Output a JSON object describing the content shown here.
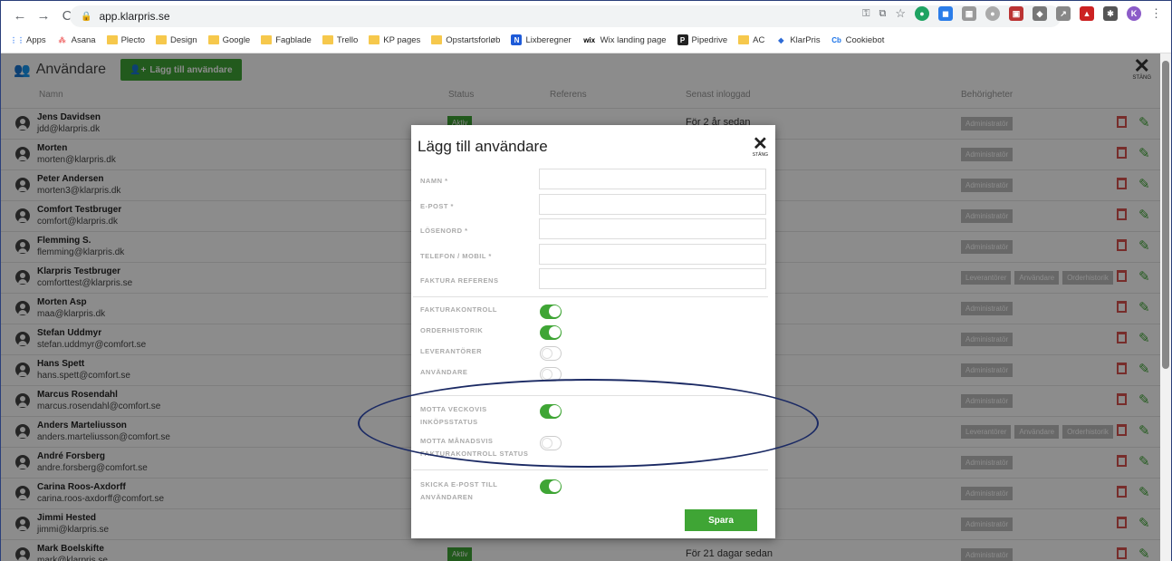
{
  "browser": {
    "url": "app.klarpris.se",
    "bookmarks": [
      {
        "label": "Apps",
        "icon": "apps-grid-icon"
      },
      {
        "label": "Asana",
        "icon": "asana-icon"
      },
      {
        "label": "Plecto",
        "icon": "folder-icon"
      },
      {
        "label": "Design",
        "icon": "folder-icon"
      },
      {
        "label": "Google",
        "icon": "folder-icon"
      },
      {
        "label": "Fagblade",
        "icon": "folder-icon"
      },
      {
        "label": "Trello",
        "icon": "folder-icon"
      },
      {
        "label": "KP pages",
        "icon": "folder-icon"
      },
      {
        "label": "Opstartsforløb",
        "icon": "folder-icon"
      },
      {
        "label": "Lixberegner",
        "icon": "n-icon"
      },
      {
        "label": "Wix landing page",
        "icon": "wix-icon"
      },
      {
        "label": "Pipedrive",
        "icon": "p-icon"
      },
      {
        "label": "AC",
        "icon": "folder-icon"
      },
      {
        "label": "KlarPris",
        "icon": "klarpris-icon"
      },
      {
        "label": "Cookiebot",
        "icon": "cookiebot-icon"
      }
    ],
    "profile_initial": "K"
  },
  "header": {
    "title": "Användare",
    "add_button": "Lägg till användare",
    "close_label": "STÄNG"
  },
  "table": {
    "columns": {
      "name": "Namn",
      "status": "Status",
      "reference": "Referens",
      "last_login": "Senast inloggad",
      "permissions": "Behörigheter"
    },
    "rows": [
      {
        "name": "Jens Davidsen",
        "email": "jdd@klarpris.dk",
        "status": "Aktiv",
        "last": "För 2 år sedan",
        "perms": [
          "Administratör"
        ]
      },
      {
        "name": "Morten",
        "email": "morten@klarpris.dk",
        "status": "",
        "last": "",
        "perms": [
          "Administratör"
        ]
      },
      {
        "name": "Peter Andersen",
        "email": "morten3@klarpris.dk",
        "status": "",
        "last": "",
        "perms": [
          "Administratör"
        ]
      },
      {
        "name": "Comfort Testbruger",
        "email": "comfort@klarpris.dk",
        "status": "",
        "last": "",
        "perms": [
          "Administratör"
        ]
      },
      {
        "name": "Flemming S.",
        "email": "flemming@klarpris.dk",
        "status": "",
        "last": "",
        "perms": [
          "Administratör"
        ]
      },
      {
        "name": "Klarpris Testbruger",
        "email": "comforttest@klarpris.se",
        "status": "",
        "last": "",
        "perms": [
          "Leverantörer",
          "Användare",
          "Orderhistorik"
        ]
      },
      {
        "name": "Morten Asp",
        "email": "maa@klarpris.dk",
        "status": "",
        "last": "",
        "perms": [
          "Administratör"
        ]
      },
      {
        "name": "Stefan Uddmyr",
        "email": "stefan.uddmyr@comfort.se",
        "status": "",
        "last": "",
        "perms": [
          "Administratör"
        ]
      },
      {
        "name": "Hans Spett",
        "email": "hans.spett@comfort.se",
        "status": "",
        "last": "",
        "perms": [
          "Administratör"
        ]
      },
      {
        "name": "Marcus Rosendahl",
        "email": "marcus.rosendahl@comfort.se",
        "status": "",
        "last": "",
        "perms": [
          "Administratör"
        ]
      },
      {
        "name": "Anders Marteliusson",
        "email": "anders.marteliusson@comfort.se",
        "status": "",
        "last": "",
        "perms": [
          "Leverantörer",
          "Användare",
          "Orderhistorik"
        ]
      },
      {
        "name": "André Forsberg",
        "email": "andre.forsberg@comfort.se",
        "status": "",
        "last": "",
        "perms": [
          "Administratör"
        ]
      },
      {
        "name": "Carina Roos-Axdorff",
        "email": "carina.roos-axdorff@comfort.se",
        "status": "",
        "last": "",
        "perms": [
          "Administratör"
        ]
      },
      {
        "name": "Jimmi Hested",
        "email": "jimmi@klarpris.se",
        "status": "",
        "last": "",
        "perms": [
          "Administratör"
        ]
      },
      {
        "name": "Mark Boelskifte",
        "email": "mark@klarpris.se",
        "status": "Aktiv",
        "last": "För 21 dagar sedan",
        "perms": [
          "Administratör"
        ]
      }
    ]
  },
  "modal": {
    "title": "Lägg till användare",
    "close_label": "STÄNG",
    "fields": [
      {
        "label": "NAMN *",
        "value": ""
      },
      {
        "label": "E-POST *",
        "value": ""
      },
      {
        "label": "LÖSENORD *",
        "value": ""
      },
      {
        "label": "TELEFON / MOBIL *",
        "value": ""
      },
      {
        "label": "FAKTURA REFERENS",
        "value": ""
      }
    ],
    "toggles_a": [
      {
        "label": "FAKTURAKONTROLL",
        "on": true
      },
      {
        "label": "ORDERHISTORIK",
        "on": true
      },
      {
        "label": "LEVERANTÖRER",
        "on": false
      },
      {
        "label": "ANVÄNDARE",
        "on": false
      }
    ],
    "toggles_b": [
      {
        "label": "MOTTA VECKOVIS INKÖPSSTATUS",
        "on": true
      },
      {
        "label": "MOTTA MÅNADSVIS FAKTURAKONTROLL STATUS",
        "on": false
      }
    ],
    "toggles_c": [
      {
        "label": "SKICKA E-POST TILL ANVÄNDAREN",
        "on": true
      }
    ],
    "save_button": "Spara"
  },
  "colors": {
    "accent": "#3fa535",
    "delete": "#d9534f",
    "annotation": "#1b2a64"
  }
}
